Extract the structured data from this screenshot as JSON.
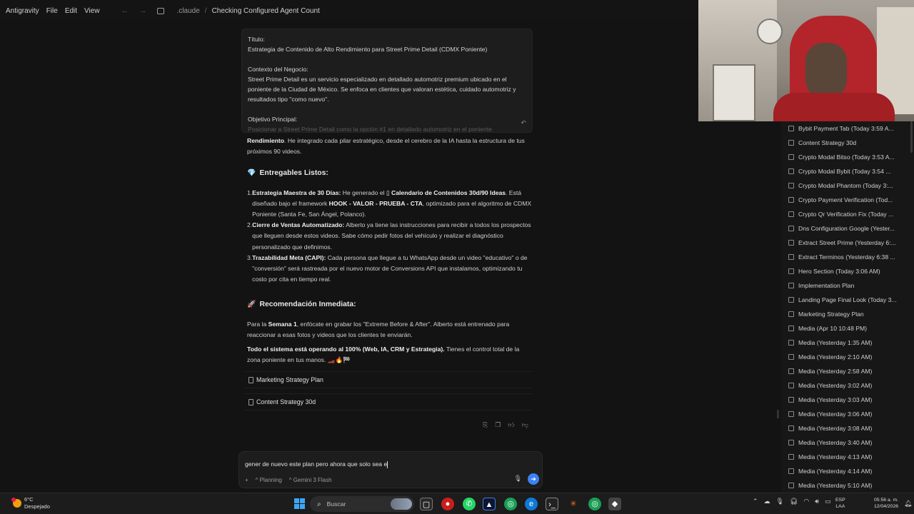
{
  "titlebar": {
    "menus": [
      "Antigravity",
      "File",
      "Edit",
      "View"
    ],
    "crumbs": [
      ".claude",
      "Checking Configured Agent Count"
    ]
  },
  "prompt_card": {
    "titulo_label": "Título:",
    "titulo": "Estrategia de Contenido de Alto Rendimiento para Street Prime Detail (CDMX Poniente)",
    "contexto_label": "Contexto del Negocio:",
    "contexto": "Street Prime Detail es un servicio especializado en detallado automotriz premium ubicado en el poniente de la Ciudad de México. Se enfoca en clientes que valoran estética, cuidado automotriz y resultados tipo \"como nuevo\".",
    "objetivo_label": "Objetivo Principal:",
    "objetivo": "Posicionar a Street Prime Detail como la opción #1 en detallado automotriz en el poniente"
  },
  "response": {
    "intro_bold": "Rendimiento",
    "intro_rest": ". He integrado cada pilar estratégico, desde el cerebro de la IA hasta la estructura de tus próximos 90 videos.",
    "entregables_icon": "💎",
    "entregables_title": "Entregables Listos:",
    "items": [
      {
        "num": "1.",
        "bold": "Estrategia Maestra de 30 Días:",
        "pre": " He generado el ",
        "link": "Calendario de Contenidos 30d/90 Ideas",
        "post": ". Está diseñado bajo el framework ",
        "bold2": "HOOK - VALOR - PRUEBA - CTA",
        "post2": ", optimizado para el algoritmo de CDMX Poniente (Santa Fe, San Ángel, Polanco)."
      },
      {
        "num": "2.",
        "bold": "Cierre de Ventas Automatizado:",
        "rest": " Alberto ya tiene las instrucciones para recibir a todos los prospectos que lleguen desde estos videos. Sabe cómo pedir fotos del vehículo y realizar el diagnóstico personalizado que definimos."
      },
      {
        "num": "3.",
        "bold": "Trazabilidad Meta (CAPI):",
        "rest": " Cada persona que llegue a tu WhatsApp desde un video \"educativo\" o de \"conversión\" será rastreada por el nuevo motor de Conversions API que instalamos, optimizando tu costo por cita en tiempo real."
      }
    ],
    "reco_icon": "🚀",
    "reco_title": "Recomendación Inmediata:",
    "reco_pre": "Para la ",
    "reco_bold": "Semana 1",
    "reco_rest": ", enfócate en grabar los \"Extreme Before & After\". Alberto está entrenado para reaccionar a esas fotos y videos que los clientes te enviarán.",
    "final_bold": "Todo el sistema está operando al 100% (Web, IA, CRM y Estrategia).",
    "final_rest": " Tienes el control total de la zona poniente en tus manos. 🏎️🔥🏁",
    "files": [
      "Marketing Strategy Plan",
      "Content Strategy 30d"
    ]
  },
  "input": {
    "value": "gener de  nuevo este plan pero ahora que solo sea e",
    "mode": "Planning",
    "model": "Gemini 3 Flash"
  },
  "conversations": [
    "Bybit Payment Tab (Today 3:59 A...",
    "Content Strategy 30d",
    "Crypto Modal Bitso (Today 3:53 A...",
    "Crypto Modal Bybit (Today 3:54 ...",
    "Crypto Modal Phantom (Today 3:...",
    "Crypto Payment Verification (Tod...",
    "Crypto Qr Verification Fix (Today ...",
    "Dns Configuration Google (Yester...",
    "Extract Street Prime (Yesterday 6:...",
    "Extract Terminos (Yesterday 6:38 ...",
    "Hero Section (Today 3:06 AM)",
    "Implementation Plan",
    "Landing Page Final Look (Today 3...",
    "Marketing Strategy Plan",
    "Media (Apr 10 10:48 PM)",
    "Media (Yesterday 1:35 AM)",
    "Media (Yesterday 2:10 AM)",
    "Media (Yesterday 2:58 AM)",
    "Media (Yesterday 3:02 AM)",
    "Media (Yesterday 3:03 AM)",
    "Media (Yesterday 3:06 AM)",
    "Media (Yesterday 3:08 AM)",
    "Media (Yesterday 3:40 AM)",
    "Media (Yesterday 4:13 AM)",
    "Media (Yesterday 4:14 AM)",
    "Media (Yesterday 5:10 AM)"
  ],
  "taskbar": {
    "temp": "6°C",
    "weather": "Despejado",
    "search": "Buscar",
    "lang1": "ESP",
    "lang2": "LAA",
    "time": "05:56 a. m.",
    "date": "12/04/2026"
  }
}
